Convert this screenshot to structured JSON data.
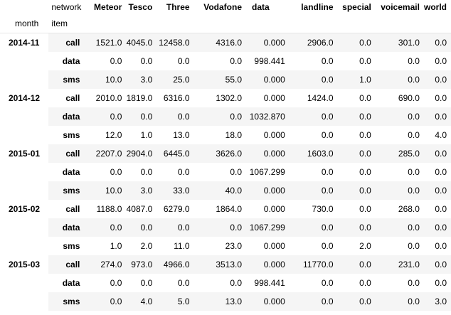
{
  "header": {
    "columns_label": "network",
    "columns": [
      "Meteor",
      "Tesco",
      "Three",
      "Vodafone",
      "data",
      "landline",
      "special",
      "voicemail",
      "world"
    ],
    "index_labels": [
      "month",
      "item"
    ]
  },
  "groups": [
    {
      "month": "2014-11",
      "rows": [
        {
          "item": "call",
          "values": [
            "1521.0",
            "4045.0",
            "12458.0",
            "4316.0",
            "0.000",
            "2906.0",
            "0.0",
            "301.0",
            "0.0"
          ]
        },
        {
          "item": "data",
          "values": [
            "0.0",
            "0.0",
            "0.0",
            "0.0",
            "998.441",
            "0.0",
            "0.0",
            "0.0",
            "0.0"
          ]
        },
        {
          "item": "sms",
          "values": [
            "10.0",
            "3.0",
            "25.0",
            "55.0",
            "0.000",
            "0.0",
            "1.0",
            "0.0",
            "0.0"
          ]
        }
      ]
    },
    {
      "month": "2014-12",
      "rows": [
        {
          "item": "call",
          "values": [
            "2010.0",
            "1819.0",
            "6316.0",
            "1302.0",
            "0.000",
            "1424.0",
            "0.0",
            "690.0",
            "0.0"
          ]
        },
        {
          "item": "data",
          "values": [
            "0.0",
            "0.0",
            "0.0",
            "0.0",
            "1032.870",
            "0.0",
            "0.0",
            "0.0",
            "0.0"
          ]
        },
        {
          "item": "sms",
          "values": [
            "12.0",
            "1.0",
            "13.0",
            "18.0",
            "0.000",
            "0.0",
            "0.0",
            "0.0",
            "4.0"
          ]
        }
      ]
    },
    {
      "month": "2015-01",
      "rows": [
        {
          "item": "call",
          "values": [
            "2207.0",
            "2904.0",
            "6445.0",
            "3626.0",
            "0.000",
            "1603.0",
            "0.0",
            "285.0",
            "0.0"
          ]
        },
        {
          "item": "data",
          "values": [
            "0.0",
            "0.0",
            "0.0",
            "0.0",
            "1067.299",
            "0.0",
            "0.0",
            "0.0",
            "0.0"
          ]
        },
        {
          "item": "sms",
          "values": [
            "10.0",
            "3.0",
            "33.0",
            "40.0",
            "0.000",
            "0.0",
            "0.0",
            "0.0",
            "0.0"
          ]
        }
      ]
    },
    {
      "month": "2015-02",
      "rows": [
        {
          "item": "call",
          "values": [
            "1188.0",
            "4087.0",
            "6279.0",
            "1864.0",
            "0.000",
            "730.0",
            "0.0",
            "268.0",
            "0.0"
          ]
        },
        {
          "item": "data",
          "values": [
            "0.0",
            "0.0",
            "0.0",
            "0.0",
            "1067.299",
            "0.0",
            "0.0",
            "0.0",
            "0.0"
          ]
        },
        {
          "item": "sms",
          "values": [
            "1.0",
            "2.0",
            "11.0",
            "23.0",
            "0.000",
            "0.0",
            "2.0",
            "0.0",
            "0.0"
          ]
        }
      ]
    },
    {
      "month": "2015-03",
      "rows": [
        {
          "item": "call",
          "values": [
            "274.0",
            "973.0",
            "4966.0",
            "3513.0",
            "0.000",
            "11770.0",
            "0.0",
            "231.0",
            "0.0"
          ]
        },
        {
          "item": "data",
          "values": [
            "0.0",
            "0.0",
            "0.0",
            "0.0",
            "998.441",
            "0.0",
            "0.0",
            "0.0",
            "0.0"
          ]
        },
        {
          "item": "sms",
          "values": [
            "0.0",
            "4.0",
            "5.0",
            "13.0",
            "0.000",
            "0.0",
            "0.0",
            "0.0",
            "3.0"
          ]
        }
      ]
    }
  ]
}
